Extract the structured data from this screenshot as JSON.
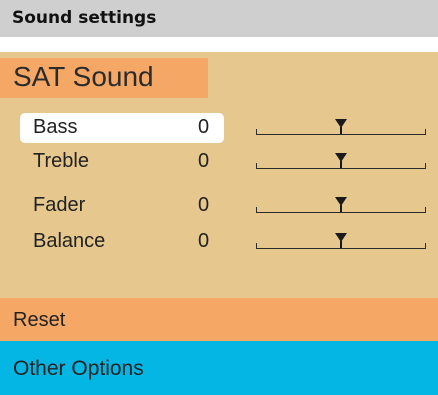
{
  "header": {
    "title": "Sound settings"
  },
  "panel": {
    "title": "SAT Sound",
    "rows": [
      {
        "label": "Bass",
        "value": "0",
        "level": 0.5,
        "selected": true
      },
      {
        "label": "Treble",
        "value": "0",
        "level": 0.5,
        "selected": false
      },
      {
        "label": "Fader",
        "value": "0",
        "level": 0.5,
        "selected": false
      },
      {
        "label": "Balance",
        "value": "0",
        "level": 0.5,
        "selected": false
      }
    ]
  },
  "reset": {
    "label": "Reset"
  },
  "other_options": {
    "label": "Other Options"
  },
  "colors": {
    "header_bg": "#cfcfcf",
    "panel_bg": "#e6c88f",
    "highlight_orange": "#f5a866",
    "options_blue": "#04b6e4",
    "selected_bg": "#ffffff"
  }
}
